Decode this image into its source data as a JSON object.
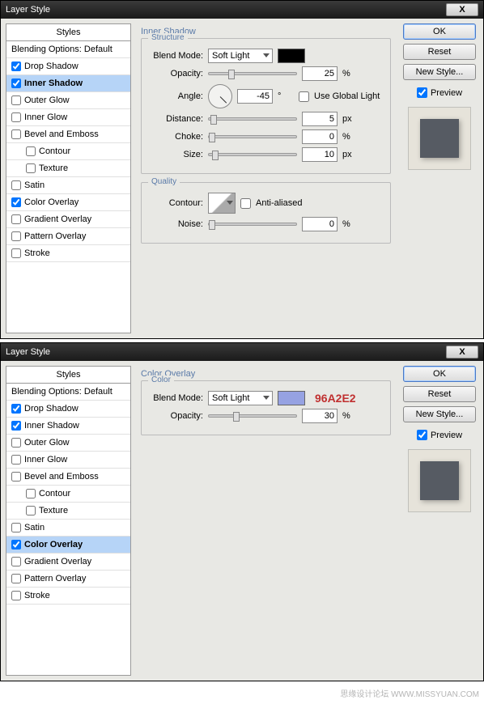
{
  "dialogs": [
    {
      "title": "Layer Style",
      "close": "X",
      "styles_header": "Styles",
      "blending_default": "Blending Options: Default",
      "styles": [
        {
          "label": "Drop Shadow",
          "checked": true,
          "selected": false
        },
        {
          "label": "Inner Shadow",
          "checked": true,
          "selected": true
        },
        {
          "label": "Outer Glow",
          "checked": false,
          "selected": false
        },
        {
          "label": "Inner Glow",
          "checked": false,
          "selected": false
        },
        {
          "label": "Bevel and Emboss",
          "checked": false,
          "selected": false
        },
        {
          "label": "Contour",
          "checked": false,
          "selected": false,
          "indent": true
        },
        {
          "label": "Texture",
          "checked": false,
          "selected": false,
          "indent": true
        },
        {
          "label": "Satin",
          "checked": false,
          "selected": false
        },
        {
          "label": "Color Overlay",
          "checked": true,
          "selected": false
        },
        {
          "label": "Gradient Overlay",
          "checked": false,
          "selected": false
        },
        {
          "label": "Pattern Overlay",
          "checked": false,
          "selected": false
        },
        {
          "label": "Stroke",
          "checked": false,
          "selected": false
        }
      ],
      "panel_title": "Inner Shadow",
      "group1": "Structure",
      "blend_mode_label": "Blend Mode:",
      "blend_mode_value": "Soft Light",
      "swatch_color": "#000000",
      "opacity_label": "Opacity:",
      "opacity_value": "25",
      "opacity_unit": "%",
      "angle_label": "Angle:",
      "angle_value": "-45",
      "angle_unit": "°",
      "global_light_label": "Use Global Light",
      "global_light_checked": false,
      "distance_label": "Distance:",
      "distance_value": "5",
      "distance_unit": "px",
      "choke_label": "Choke:",
      "choke_value": "0",
      "choke_unit": "%",
      "size_label": "Size:",
      "size_value": "10",
      "size_unit": "px",
      "group2": "Quality",
      "contour_label": "Contour:",
      "antialias_label": "Anti-aliased",
      "antialias_checked": false,
      "noise_label": "Noise:",
      "noise_value": "0",
      "noise_unit": "%",
      "buttons": {
        "ok": "OK",
        "reset": "Reset",
        "new_style": "New Style..."
      },
      "preview_label": "Preview",
      "preview_checked": true
    },
    {
      "title": "Layer Style",
      "close": "X",
      "styles_header": "Styles",
      "blending_default": "Blending Options: Default",
      "styles": [
        {
          "label": "Drop Shadow",
          "checked": true,
          "selected": false
        },
        {
          "label": "Inner Shadow",
          "checked": true,
          "selected": false
        },
        {
          "label": "Outer Glow",
          "checked": false,
          "selected": false
        },
        {
          "label": "Inner Glow",
          "checked": false,
          "selected": false
        },
        {
          "label": "Bevel and Emboss",
          "checked": false,
          "selected": false
        },
        {
          "label": "Contour",
          "checked": false,
          "selected": false,
          "indent": true
        },
        {
          "label": "Texture",
          "checked": false,
          "selected": false,
          "indent": true
        },
        {
          "label": "Satin",
          "checked": false,
          "selected": false
        },
        {
          "label": "Color Overlay",
          "checked": true,
          "selected": true
        },
        {
          "label": "Gradient Overlay",
          "checked": false,
          "selected": false
        },
        {
          "label": "Pattern Overlay",
          "checked": false,
          "selected": false
        },
        {
          "label": "Stroke",
          "checked": false,
          "selected": false
        }
      ],
      "panel_title": "Color Overlay",
      "group1": "Color",
      "blend_mode_label": "Blend Mode:",
      "blend_mode_value": "Soft Light",
      "swatch_color": "#96A2E2",
      "hex_annotation": "96A2E2",
      "opacity_label": "Opacity:",
      "opacity_value": "30",
      "opacity_unit": "%",
      "buttons": {
        "ok": "OK",
        "reset": "Reset",
        "new_style": "New Style..."
      },
      "preview_label": "Preview",
      "preview_checked": true
    }
  ],
  "watermark": "思缘设计论坛  WWW.MISSYUAN.COM"
}
